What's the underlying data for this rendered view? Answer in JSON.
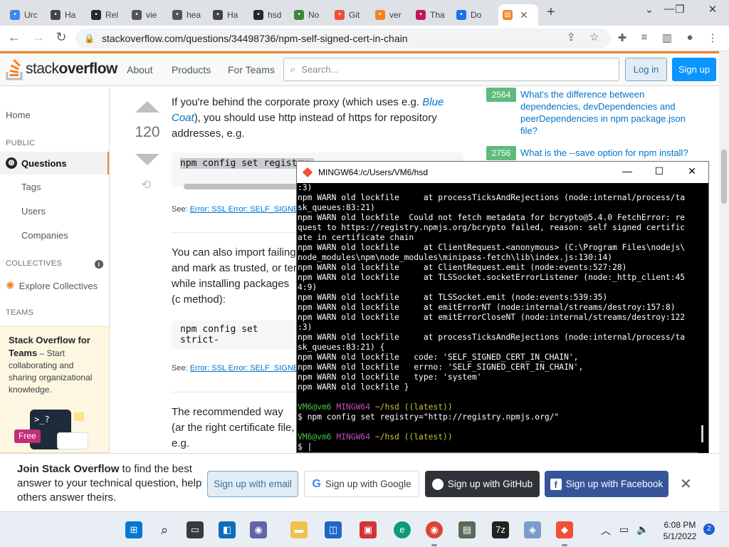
{
  "browser": {
    "tabs": [
      {
        "label": "Urc",
        "color": "#4285f4"
      },
      {
        "label": "Ha",
        "color": "#444"
      },
      {
        "label": "Rel",
        "color": "#24292f"
      },
      {
        "label": "vie",
        "color": "#555"
      },
      {
        "label": "hea",
        "color": "#555"
      },
      {
        "label": "Ha",
        "color": "#444"
      },
      {
        "label": "hsd",
        "color": "#24292f"
      },
      {
        "label": "No",
        "color": "#3c873a"
      },
      {
        "label": "Git",
        "color": "#f05033"
      },
      {
        "label": "ver",
        "color": "#f48225"
      },
      {
        "label": "Tha",
        "color": "#c2185b"
      },
      {
        "label": "Do",
        "color": "#1a73e8"
      }
    ],
    "active_tab_color": "#f48225",
    "url": "stackoverflow.com/questions/34498736/npm-self-signed-cert-in-chain"
  },
  "so": {
    "logo_stack": "stack",
    "logo_overflow": "overflow",
    "nav": {
      "about": "About",
      "products": "Products",
      "teams": "For Teams"
    },
    "search_placeholder": "Search...",
    "login": "Log in",
    "signup": "Sign up"
  },
  "sidebar": {
    "home": "Home",
    "public": "PUBLIC",
    "questions": "Questions",
    "tags": "Tags",
    "users": "Users",
    "companies": "Companies",
    "collectives": "COLLECTIVES",
    "explore": "Explore Collectives",
    "teams": "TEAMS",
    "teams_title": "Stack Overflow for Teams",
    "teams_desc": " – Start collaborating and sharing organizational knowledge.",
    "free": "Free"
  },
  "answer": {
    "votes": "120",
    "p1_a": "If you're behind the corporate proxy (which uses e.g. ",
    "p1_link": "Blue Coat",
    "p1_b": "), you should use http instead of https for repository addresses, e.g.",
    "code1": "npm config set registry=",
    "see_label": "See: ",
    "see1": "Error: SSL Error: SELF_SIGNED",
    "p2": "You can also import failing and mark as trusted, or ter while installing packages (c method):",
    "code2": "npm config set strict-",
    "see2": "Error: SSL Error: SELF_SIGNED",
    "p3": "The recommended way (ar the right certificate file, e.g."
  },
  "related": [
    {
      "score": "2564",
      "title": "What's the difference between dependencies, devDependencies and peerDependencies in npm package.json file?"
    },
    {
      "score": "2756",
      "title": "What is the --save option for npm install?"
    }
  ],
  "terminal": {
    "title": "MINGW64:/c/Users/VM6/hsd",
    "lines": [
      ":3)",
      "npm WARN old lockfile     at processTicksAndRejections (node:internal/process/ta",
      "sk_queues:83:21)",
      "npm WARN old lockfile  Could not fetch metadata for bcrypto@5.4.0 FetchError: re",
      "quest to https://registry.npmjs.org/bcrypto failed, reason: self signed certific",
      "ate in certificate chain",
      "npm WARN old lockfile     at ClientRequest.<anonymous> (C:\\Program Files\\nodejs\\",
      "node_modules\\npm\\node_modules\\minipass-fetch\\lib\\index.js:130:14)",
      "npm WARN old lockfile     at ClientRequest.emit (node:events:527:28)",
      "npm WARN old lockfile     at TLSSocket.socketErrorListener (node:_http_client:45",
      "4:9)",
      "npm WARN old lockfile     at TLSSocket.emit (node:events:539:35)",
      "npm WARN old lockfile     at emitErrorNT (node:internal/streams/destroy:157:8)",
      "npm WARN old lockfile     at emitErrorCloseNT (node:internal/streams/destroy:122",
      ":3)",
      "npm WARN old lockfile     at processTicksAndRejections (node:internal/process/ta",
      "sk_queues:83:21) {",
      "npm WARN old lockfile   code: 'SELF_SIGNED_CERT_IN_CHAIN',",
      "npm WARN old lockfile   errno: 'SELF_SIGNED_CERT_IN_CHAIN',",
      "npm WARN old lockfile   type: 'system'",
      "npm WARN old lockfile }"
    ],
    "prompt_user": "VM6@vm6",
    "prompt_env": "MINGW64",
    "prompt_dir": "~/hsd ((latest))",
    "command": "$ npm config set registry=\"http://registry.npmjs.org/\"",
    "prompt_user2": "VM6@vm6",
    "prompt_env2": "MINGW64",
    "prompt_dir2": "~/hsd ((latest))",
    "cursor_line": "$ |"
  },
  "banner": {
    "bold": "Join Stack Overflow",
    "text": " to find the best answer to your technical question, help others answer theirs.",
    "email": "Sign up with email",
    "google": "Sign up with Google",
    "github": "Sign up with GitHub",
    "facebook": "Sign up with Facebook"
  },
  "taskbar": {
    "time": "6:08 PM",
    "date": "5/1/2022",
    "notifications": "2"
  }
}
